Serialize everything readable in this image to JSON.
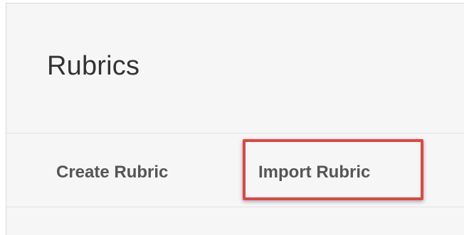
{
  "page": {
    "title": "Rubrics"
  },
  "actions": {
    "create_label": "Create Rubric",
    "import_label": "Import Rubric"
  },
  "colors": {
    "highlight": "#e04545",
    "background": "#f6f6f6",
    "text": "#333333",
    "link_text": "#555555"
  }
}
